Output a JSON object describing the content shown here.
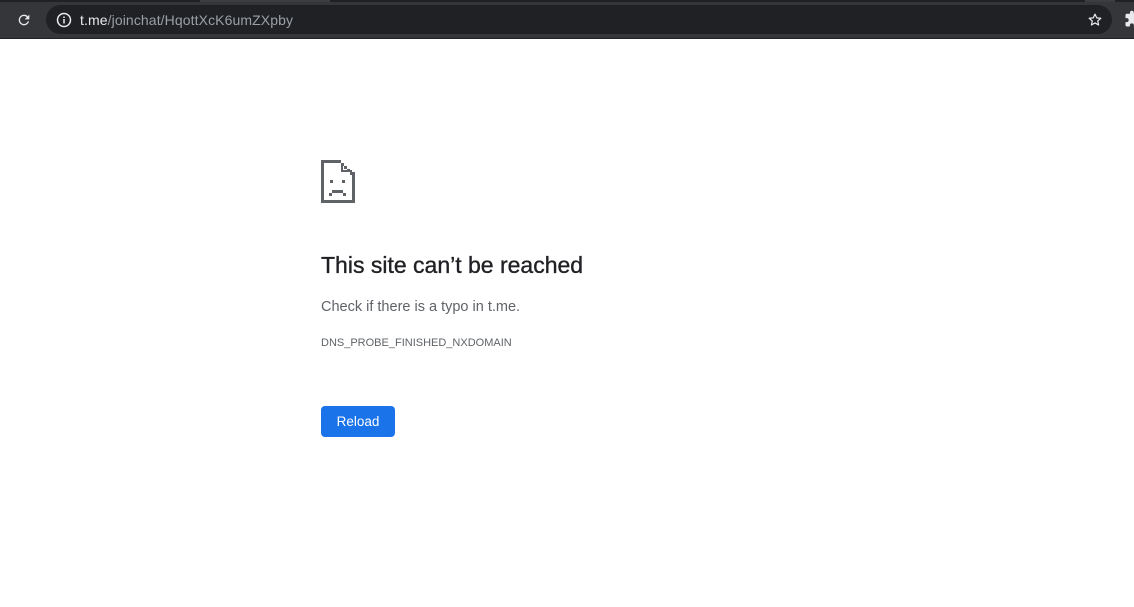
{
  "toolbar": {
    "url_host": "t.me",
    "url_path": "/joinchat/HqottXcK6umZXpby",
    "icons": {
      "reload": "reload-icon",
      "site_info": "info-icon",
      "bookmark": "star-icon",
      "extensions": "puzzle-icon"
    }
  },
  "error_page": {
    "icon": "sad-page-icon",
    "title": "This site can’t be reached",
    "description": "Check if there is a typo in t.me.",
    "error_code": "DNS_PROBE_FINISHED_NXDOMAIN",
    "reload_label": "Reload"
  },
  "colors": {
    "toolbar_bg": "#35363a",
    "omnibox_bg": "#202124",
    "accent": "#1a73e8",
    "title_text": "#202124",
    "secondary_text": "#5f6368"
  }
}
